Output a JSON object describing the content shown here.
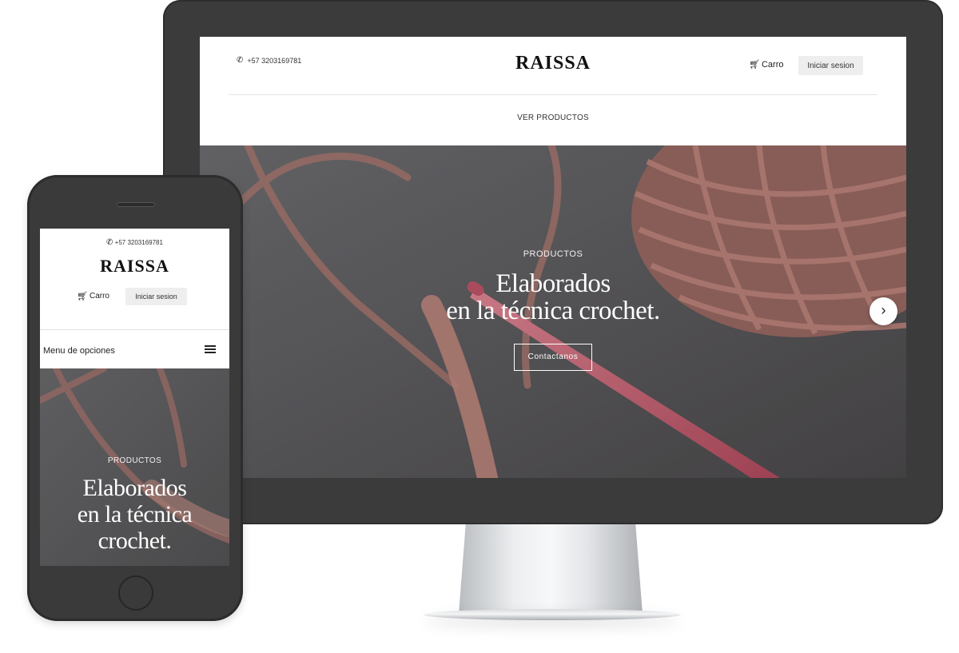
{
  "site": {
    "brand": "RAISSA",
    "phone": "+57 3203169781",
    "cart_label": "Carro",
    "login_label": "Iniciar sesion",
    "nav_link": "VER PRODUCTOS",
    "menu_label": "Menu de opciones"
  },
  "hero": {
    "eyebrow": "PRODUCTOS",
    "title_line1": "Elaborados",
    "title_line2": "en la técnica crochet.",
    "mobile_title_line1": "Elaborados",
    "mobile_title_line2": "en la técnica",
    "mobile_title_line3": "crochet.",
    "button_label": "Contactanos"
  },
  "icons": {
    "phone": "phone-icon",
    "cart": "cart-icon",
    "next": "chevron-right-icon",
    "menu": "hamburger-icon"
  },
  "colors": {
    "device_frame": "#3b3b3b",
    "button_bg": "#eeeeee",
    "yarn": "#c9877c",
    "hook": "#d46a7c"
  }
}
